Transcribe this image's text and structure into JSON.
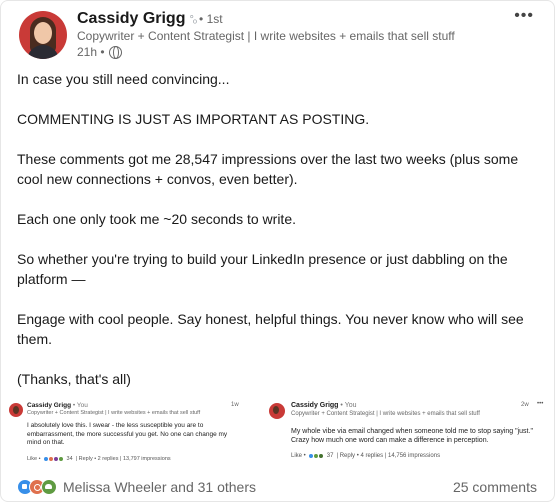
{
  "author": {
    "name": "Cassidy Grigg",
    "degree": "• 1st",
    "headline": "Copywriter + Content Strategist | I write websites + emails that sell stuff",
    "time": "21h •"
  },
  "post": {
    "paragraphs": [
      "In case you still need convincing...",
      "COMMENTING IS JUST AS IMPORTANT AS POSTING.",
      "These comments got me 28,547 impressions over the last two weeks (plus some cool new connections + convos, even better).",
      "Each one only took me ~20 seconds to write.",
      "So whether you're trying to build your LinkedIn presence or just dabbling on the platform —",
      "Engage with cool people. Say honest, helpful things. You never know who will see them.",
      "(Thanks, that's all)"
    ]
  },
  "comment_shots": [
    {
      "name": "Cassidy Grigg",
      "you": "• You",
      "headline": "Copywriter + Content Strategist | I write websites + emails that sell stuff",
      "time": "1w",
      "body": "I absolutely love this. I swear - the less susceptible you are to embarrassment, the more successful you get. No one can change my mind on that.",
      "actions": "Like •",
      "reaction_count": "34",
      "reply": "| Reply • 2 replies | 13,797 impressions"
    },
    {
      "name": "Cassidy Grigg",
      "you": "• You",
      "headline": "Copywriter + Content Strategist | I write websites + emails that sell stuff",
      "time": "2w",
      "body": "My whole vibe via email changed when someone told me to stop saying \"just.\" Crazy how much one word can make a difference in perception.",
      "actions": "Like •",
      "reaction_count": "37",
      "reply": "| Reply • 4 replies | 14,756 impressions"
    }
  ],
  "footer": {
    "reactors": "Melissa Wheeler and 31 others",
    "comments": "25 comments"
  },
  "colors": {
    "like": "#378fe9",
    "celebrate": "#df704d",
    "support": "#5f9b41",
    "avatar_bg": "#c93a37"
  }
}
